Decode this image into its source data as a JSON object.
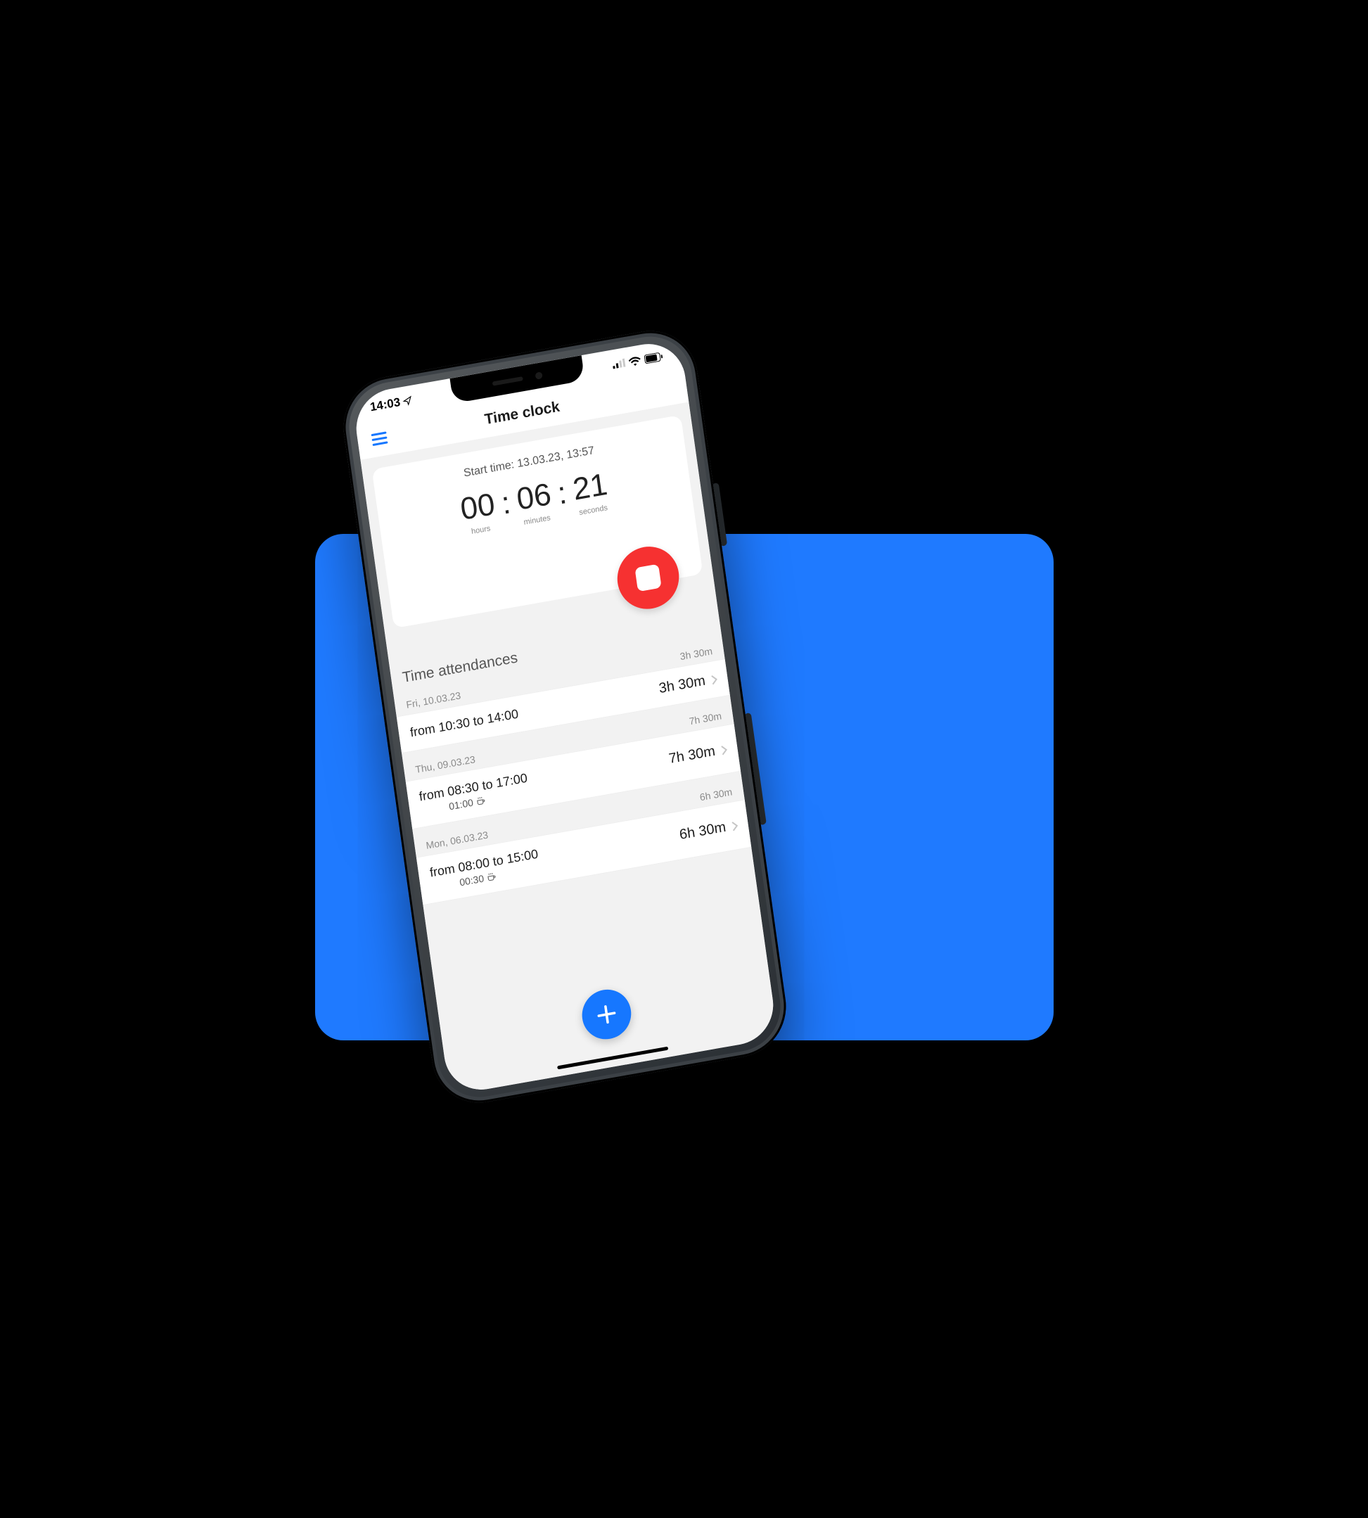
{
  "status": {
    "time": "14:03"
  },
  "header": {
    "title": "Time clock"
  },
  "timer": {
    "start_label_prefix": "Start time:",
    "start_datetime": "13.03.23, 13:57",
    "hours": "00",
    "minutes": "06",
    "seconds": "21",
    "unit_hours": "hours",
    "unit_minutes": "minutes",
    "unit_seconds": "seconds"
  },
  "section": {
    "attendances_title": "Time attendances"
  },
  "days": [
    {
      "label": "Fri, 10.03.23",
      "total": "3h 30m",
      "entry": {
        "range": "from 10:30 to 14:00",
        "break": "",
        "duration": "3h 30m"
      }
    },
    {
      "label": "Thu, 09.03.23",
      "total": "7h 30m",
      "entry": {
        "range": "from 08:30 to 17:00",
        "break": "01:00",
        "duration": "7h 30m"
      }
    },
    {
      "label": "Mon, 06.03.23",
      "total": "6h 30m",
      "entry": {
        "range": "from 08:00 to 15:00",
        "break": "00:30",
        "duration": "6h 30m"
      }
    }
  ],
  "icons": {
    "break": "coffee-icon"
  },
  "colors": {
    "accent": "#1677ff",
    "stop": "#f63131",
    "stage_blue": "#1f7aff"
  }
}
